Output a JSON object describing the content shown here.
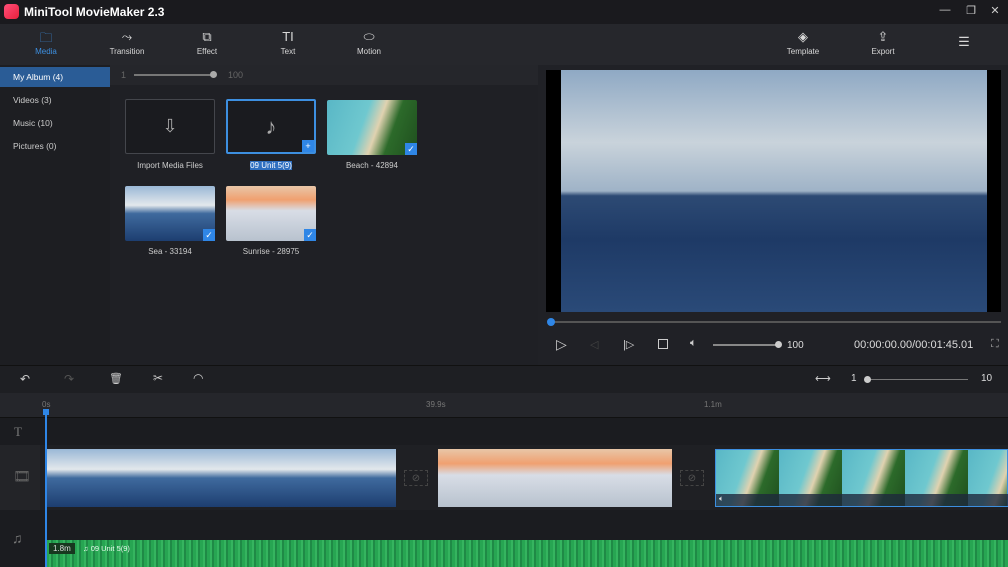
{
  "app": {
    "title": "MiniTool MovieMaker 2.3"
  },
  "toolbar": {
    "items": [
      {
        "label": "Media",
        "icon": "folder-icon"
      },
      {
        "label": "Transition",
        "icon": "transition-icon"
      },
      {
        "label": "Effect",
        "icon": "effect-icon"
      },
      {
        "label": "Text",
        "icon": "text-icon"
      },
      {
        "label": "Motion",
        "icon": "motion-icon"
      }
    ],
    "template": "Template",
    "export": "Export"
  },
  "sidebar": {
    "items": [
      {
        "label": "My Album",
        "count": "(4)"
      },
      {
        "label": "Videos",
        "count": "(3)"
      },
      {
        "label": "Music",
        "count": "(10)"
      },
      {
        "label": "Pictures",
        "count": "(0)"
      }
    ]
  },
  "media": {
    "zoom_min": "1",
    "zoom_max": "100",
    "items": [
      {
        "label": "Import Media Files"
      },
      {
        "label": "09 Unit 5(9)"
      },
      {
        "label": "Beach - 42894"
      },
      {
        "label": "Sea - 33194"
      },
      {
        "label": "Sunrise - 28975"
      }
    ]
  },
  "player": {
    "volume": "100",
    "time": "00:00:00.00/00:01:45.01",
    "progress": 0
  },
  "timeline": {
    "zoom_min": "1",
    "zoom_max": "10",
    "ticks": [
      "0s",
      "39.9s",
      "1.1m"
    ],
    "audio_duration": "1.8m",
    "audio_name": "09 Unit 5(9)"
  }
}
